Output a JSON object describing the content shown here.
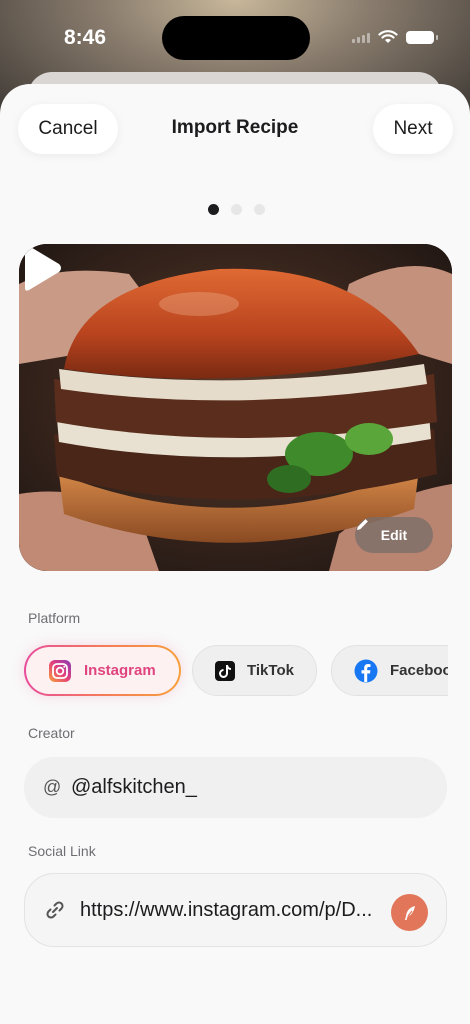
{
  "status": {
    "time": "8:46"
  },
  "nav": {
    "cancel_label": "Cancel",
    "title": "Import Recipe",
    "next_label": "Next"
  },
  "pager": {
    "count": 3,
    "active_index": 0
  },
  "media": {
    "edit_label": "Edit",
    "play_icon": "play-icon",
    "edit_icon": "pencil-icon"
  },
  "platform": {
    "label": "Platform",
    "options": [
      {
        "name": "Instagram",
        "icon": "instagram-icon",
        "selected": true
      },
      {
        "name": "TikTok",
        "icon": "tiktok-icon",
        "selected": false
      },
      {
        "name": "Facebook",
        "icon": "facebook-icon",
        "selected": false
      }
    ]
  },
  "creator": {
    "label": "Creator",
    "prefix": "@",
    "value": "@alfskitchen_"
  },
  "social_link": {
    "label": "Social Link",
    "value": "https://www.instagram.com/p/D..."
  },
  "colors": {
    "accent": "#e2765a",
    "instagram_text": "#e0457f",
    "background": "#f9f9f9"
  }
}
